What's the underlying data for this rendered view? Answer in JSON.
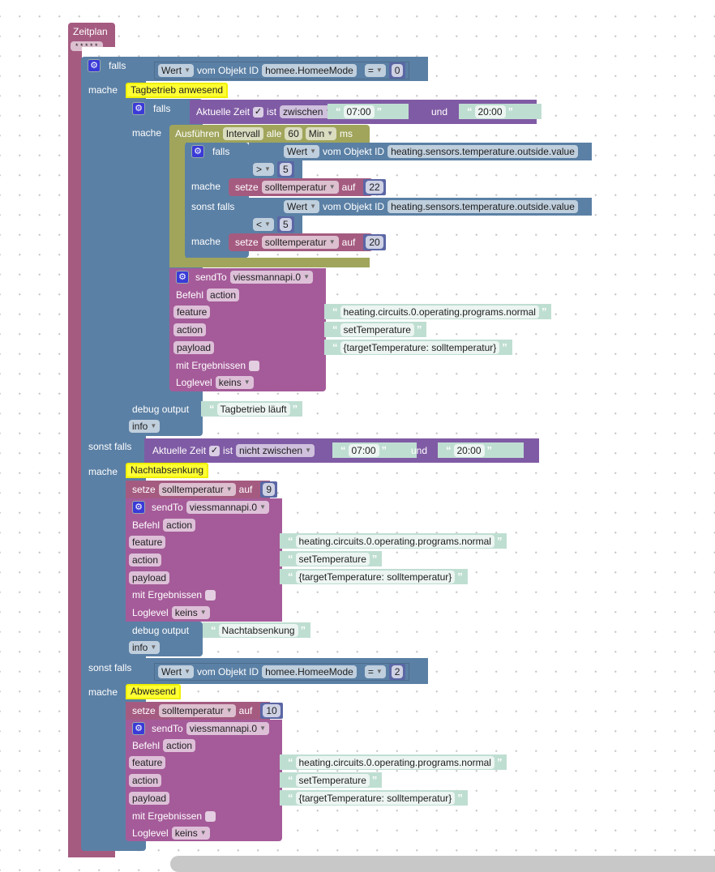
{
  "colors": {
    "logic": "#5b80a5",
    "schedule": "#a55b80",
    "interval": "#a0a55b",
    "time": "#805ba5",
    "sendto": "#a55b99",
    "variable": "#a55b80",
    "number": "#5b67a5",
    "text": "#bfded2",
    "comment": "#ffff33"
  },
  "schedule": {
    "title": "Zeitplan",
    "cron": "* * * * *"
  },
  "if1": {
    "falls": "falls",
    "mache": "mache",
    "sonst1": "sonst falls",
    "mache2": "mache",
    "sonst2": "sonst falls",
    "mache3": "mache",
    "cond": {
      "wert": "Wert",
      "vom": "vom Objekt ID",
      "id": "homee.HomeeMode",
      "op": "=",
      "value": "0"
    },
    "cond3": {
      "wert": "Wert",
      "vom": "vom Objekt ID",
      "id": "homee.HomeeMode",
      "op": "=",
      "value": "2"
    }
  },
  "comments": [
    "Tagbetrieb anwesend",
    "Nachtabsenkung",
    "Abwesend"
  ],
  "if2": {
    "falls": "falls",
    "mache": "mache",
    "time": {
      "label": "Aktuelle Zeit",
      "check": "✓",
      "ist": "ist",
      "mode": "zwischen",
      "from": "07:00",
      "und": "und",
      "to": "20:00"
    }
  },
  "time2": {
    "label": "Aktuelle Zeit",
    "check": "✓",
    "ist": "ist",
    "mode": "nicht zwischen",
    "from": "07:00",
    "und": "und",
    "to": "20:00"
  },
  "interval": {
    "exec": "Ausführen",
    "type": "Intervall",
    "alle": "alle",
    "value": "60",
    "unit": "Min",
    "ms": "ms"
  },
  "if3": {
    "falls": "falls",
    "mache": "mache",
    "sonst": "sonst falls",
    "mache2": "mache",
    "cond1": {
      "wert": "Wert",
      "vom": "vom Objekt ID",
      "id": "heating.sensors.temperature.outside.value",
      "op": ">",
      "value": "5"
    },
    "cond2": {
      "wert": "Wert",
      "vom": "vom Objekt ID",
      "id": "heating.sensors.temperature.outside.value",
      "op": "<",
      "value": "5"
    }
  },
  "set": {
    "setze": "setze",
    "var": "solltemperatur",
    "auf": "auf",
    "values": [
      "22",
      "20",
      "9",
      "10"
    ]
  },
  "sendto": {
    "label": "sendTo",
    "instance": "viessmannapi.0",
    "befehl": "Befehl",
    "command": "action",
    "feature": "feature",
    "action": "action",
    "payload": "payload",
    "feature_val": "heating.circuits.0.operating.programs.normal",
    "action_val": "setTemperature",
    "payload_val": "{targetTemperature: solltemperatur}",
    "mit": "mit Ergebnissen",
    "loglevel": "Loglevel",
    "loglevel_val": "keins"
  },
  "debug": {
    "label": "debug output",
    "texts": [
      "Tagbetrieb läuft",
      "Nachtabsenkung"
    ],
    "level": "info"
  }
}
